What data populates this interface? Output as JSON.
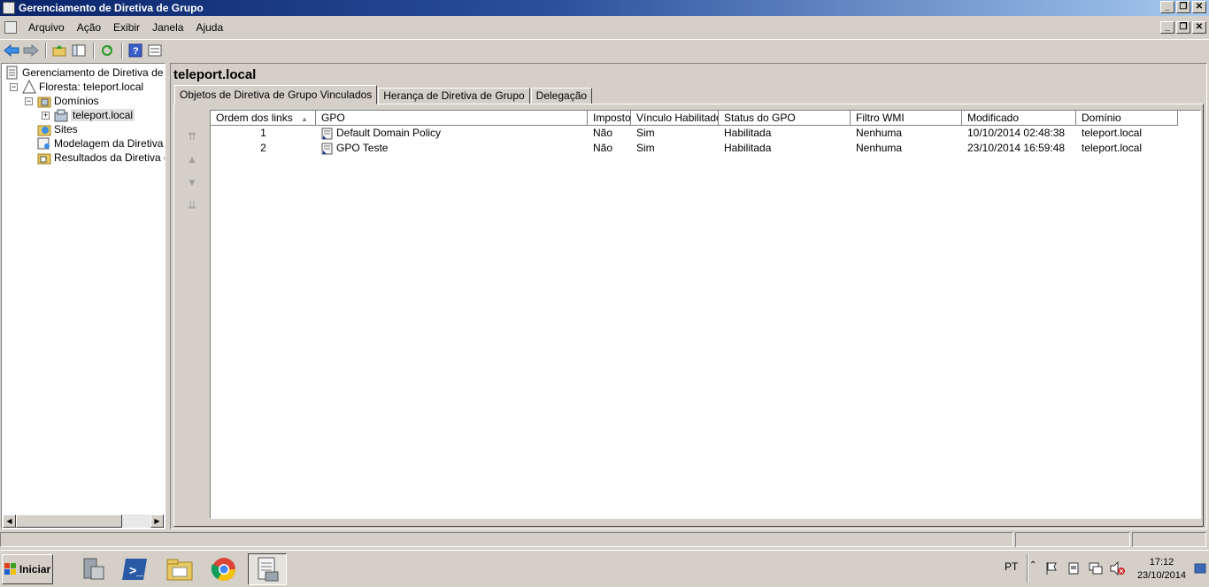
{
  "window": {
    "title": "Gerenciamento de Diretiva de Grupo"
  },
  "menu": {
    "items": [
      "Arquivo",
      "Ação",
      "Exibir",
      "Janela",
      "Ajuda"
    ]
  },
  "tree": {
    "items": [
      {
        "label": "Gerenciamento de Diretiva de Grupo",
        "level": 0,
        "expander": ""
      },
      {
        "label": "Floresta: teleport.local",
        "level": 1,
        "expander": "−"
      },
      {
        "label": "Domínios",
        "level": 2,
        "expander": "−"
      },
      {
        "label": "teleport.local",
        "level": 3,
        "expander": "+"
      },
      {
        "label": "Sites",
        "level": 2,
        "expander": ""
      },
      {
        "label": "Modelagem da Diretiva de Grupo",
        "level": 2,
        "expander": ""
      },
      {
        "label": "Resultados da Diretiva de Grupo",
        "level": 2,
        "expander": ""
      }
    ]
  },
  "main": {
    "title": "teleport.local",
    "tabs": [
      {
        "label": "Objetos de Diretiva de Grupo Vinculados",
        "active": true
      },
      {
        "label": "Herança de Diretiva de Grupo",
        "active": false
      },
      {
        "label": "Delegação",
        "active": false
      }
    ],
    "columns": [
      "Ordem dos links",
      "GPO",
      "Imposto",
      "Vínculo Habilitado",
      "Status do GPO",
      "Filtro WMI",
      "Modificado",
      "Domínio"
    ],
    "sort_indicator": "▲",
    "rows": [
      {
        "order": "1",
        "gpo": "Default Domain Policy",
        "enforced": "Não",
        "link_enabled": "Sim",
        "status": "Habilitada",
        "wmi": "Nenhuma",
        "modified": "10/10/2014 02:48:38",
        "domain": "teleport.local"
      },
      {
        "order": "2",
        "gpo": "GPO Teste",
        "enforced": "Não",
        "link_enabled": "Sim",
        "status": "Habilitada",
        "wmi": "Nenhuma",
        "modified": "23/10/2014 16:59:48",
        "domain": "teleport.local"
      }
    ]
  },
  "taskbar": {
    "start_label": "Iniciar",
    "language": "PT",
    "time": "17:12",
    "date": "23/10/2014"
  },
  "colors": {
    "titlebar": "#0a246a",
    "chrome": "#d4d0c8"
  }
}
